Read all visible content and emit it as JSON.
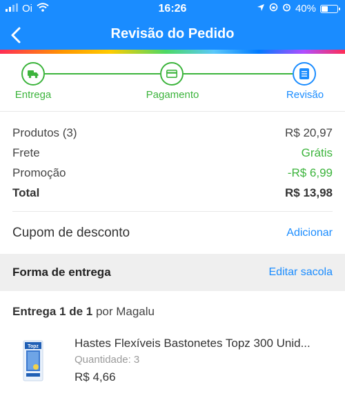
{
  "status_bar": {
    "carrier": "Oi",
    "time": "16:26",
    "battery": "40%"
  },
  "header": {
    "title": "Revisão do Pedido"
  },
  "stepper": {
    "steps": [
      {
        "label": "Entrega",
        "icon": "truck-icon",
        "state": "done"
      },
      {
        "label": "Pagamento",
        "icon": "card-icon",
        "state": "done"
      },
      {
        "label": "Revisão",
        "icon": "list-icon",
        "state": "active"
      }
    ],
    "colors": {
      "done": "#3cb43c",
      "active": "#1a8cff"
    }
  },
  "summary": {
    "products_label": "Produtos (3)",
    "products_value": "R$ 20,97",
    "shipping_label": "Frete",
    "shipping_value": "Grátis",
    "promo_label": "Promoção",
    "promo_value": "-R$ 6,99",
    "total_label": "Total",
    "total_value": "R$ 13,98"
  },
  "coupon": {
    "label": "Cupom de desconto",
    "action": "Adicionar"
  },
  "delivery_method": {
    "label": "Forma de entrega",
    "action": "Editar sacola"
  },
  "delivery": {
    "prefix": "Entrega 1 de 1",
    "suffix": " por Magalu"
  },
  "product": {
    "name": "Hastes Flexíveis Bastonetes Topz 300 Unid...",
    "quantity": "Quantidade: 3",
    "price": "R$ 4,66",
    "thumb_brand": "Topz"
  },
  "colors": {
    "brand_blue": "#1a8cff",
    "success_green": "#3cb43c"
  }
}
